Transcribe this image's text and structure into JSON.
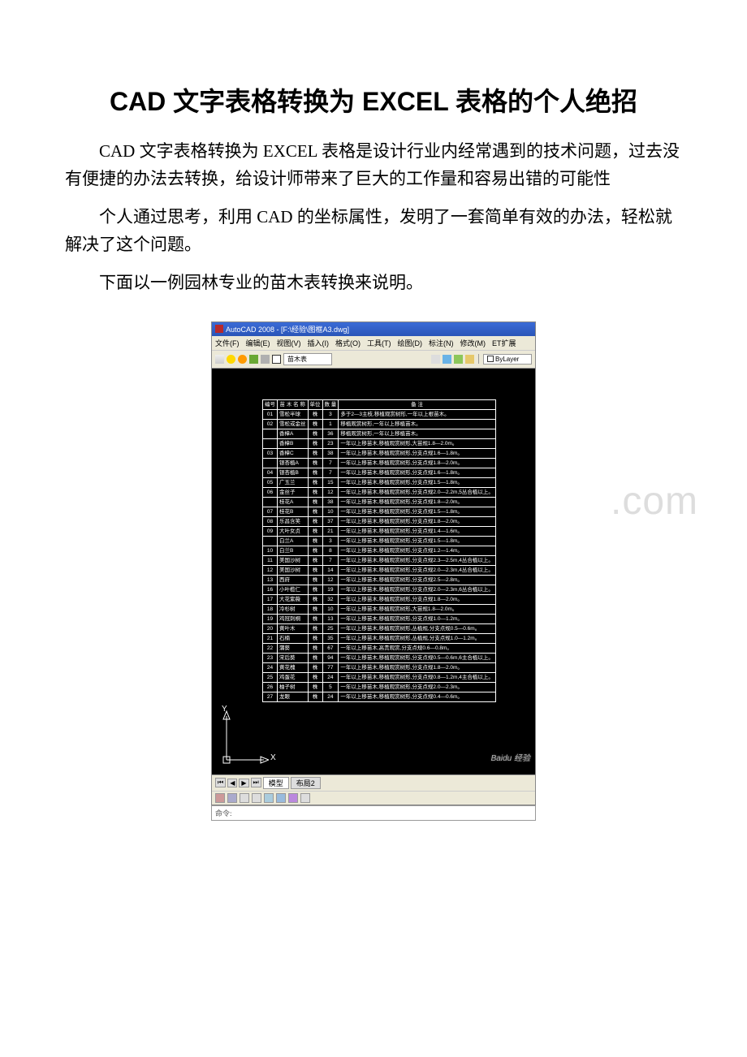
{
  "title": "CAD 文字表格转换为 EXCEL 表格的个人绝招",
  "para1": "CAD 文字表格转换为 EXCEL 表格是设计行业内经常遇到的技术问题，过去没有便捷的办法去转换，给设计师带来了巨大的工作量和容易出错的可能性",
  "para2": "个人通过思考，利用 CAD 的坐标属性，发明了一套简单有效的办法，轻松就解决了这个问题。",
  "para3": "下面以一例园林专业的苗木表转换来说明。",
  "watermark": ".com",
  "window": {
    "app": "AutoCAD 2008 - [F:\\经验\\图框A3.dwg]",
    "menus": [
      "文件(F)",
      "编辑(E)",
      "视图(V)",
      "插入(I)",
      "格式(O)",
      "工具(T)",
      "绘图(D)",
      "标注(N)",
      "修改(M)",
      "ET扩展"
    ],
    "layer_name": "苗木表",
    "bylayer": "ByLayer",
    "model_tab": "模型",
    "layout_tab": "布局2",
    "cmd_label": "命令:",
    "baidu": "Baidu 经验",
    "ucs_x": "X",
    "ucs_y": "Y"
  },
  "table": {
    "header": [
      "编号",
      "苗 木 名 称",
      "单位",
      "数 量",
      "备  注"
    ],
    "rows": [
      [
        "01",
        "雪松半球",
        "株",
        "3",
        "多于2—3主枝,移植观赏树形,一年以上根苗木。"
      ],
      [
        "02",
        "雪松或金丝",
        "株",
        "1",
        "移植观赏树形,一年以上移植苗木。"
      ],
      [
        "",
        "香樟A",
        "株",
        "36",
        "移植观赏树形,一年以上移植苗木。"
      ],
      [
        "",
        "香樟B",
        "株",
        "23",
        "一年以上移苗木,移植观赏树形,大苗规1.8—2.0m。"
      ],
      [
        "03",
        "香樟C",
        "株",
        "38",
        "一年以上移苗木,移植观赏树形,分支点规1.6—1.8m。"
      ],
      [
        "",
        "银杏植A",
        "株",
        "7",
        "一年以上移苗木,移植观赏树形,分支点规1.8—2.0m。"
      ],
      [
        "04",
        "银杏植B",
        "株",
        "7",
        "一年以上移苗木,移植观赏树形,分支点规1.6—1.8m。"
      ],
      [
        "05",
        "广玉兰",
        "株",
        "15",
        "一年以上移苗木,移植观赏树形,分支点规1.5—1.8m。"
      ],
      [
        "06",
        "金丝子",
        "株",
        "12",
        "一年以上移苗木,移植观赏树形,分支点规2.0—2.2m,5丛合植以上。"
      ],
      [
        "",
        "桂花A",
        "株",
        "38",
        "一年以上移苗木,移植观赏树形,分支点规1.8—2.0m。"
      ],
      [
        "07",
        "桂花B",
        "株",
        "10",
        "一年以上移苗木,移植观赏树形,分支点规1.5—1.8m。"
      ],
      [
        "08",
        "乐昌含笑",
        "株",
        "37",
        "一年以上移苗木,移植观赏树形,分支点规1.8—2.0m。"
      ],
      [
        "09",
        "大叶女贞",
        "株",
        "21",
        "一年以上移苗木,移植观赏树形,分支点规1.4—1.6m。"
      ],
      [
        "",
        "白兰A",
        "株",
        "3",
        "一年以上移苗木,移植观赏树形,分支点规1.5—1.8m。"
      ],
      [
        "10",
        "白兰B",
        "株",
        "8",
        "一年以上移苗木,移植观赏树形,分支点规1.2—1.4m。"
      ],
      [
        "11",
        "美国沙树",
        "株",
        "7",
        "一年以上移苗木,移植观赏树形,分支点规2.3—2.5m,4丛合植以上。"
      ],
      [
        "12",
        "美国沙树",
        "株",
        "14",
        "一年以上移苗木,移植观赏树形,分支点规2.0—2.3m,4丛合植以上。"
      ],
      [
        "13",
        "西府",
        "株",
        "12",
        "一年以上移苗木,移植观赏树形,分支点规2.5—2.8m。"
      ],
      [
        "16",
        "小叶榄仁",
        "株",
        "19",
        "一年以上移苗木,移植观赏树形,分支点规2.0—2.3m,6丛合植以上。"
      ],
      [
        "17",
        "大花紫薇",
        "株",
        "32",
        "一年以上移苗木,移植观赏树形,分支点规1.8—2.0m。"
      ],
      [
        "18",
        "冷杉树",
        "株",
        "10",
        "一年以上移苗木,移植观赏树形,大苗规1.8—2.0m。"
      ],
      [
        "19",
        "鸡冠刺桐",
        "株",
        "13",
        "一年以上移苗木,移植观赏树形,分支点规1.0—1.2m。"
      ],
      [
        "20",
        "黄叶木",
        "株",
        "25",
        "一年以上移苗木,移植观赏树形,丛植规,分支点规0.5—0.6m。"
      ],
      [
        "21",
        "石楠",
        "株",
        "35",
        "一年以上移苗木,移植观赏树形,丛植规,分支点规1.0—1.2m。"
      ],
      [
        "22",
        "蒲葵",
        "株",
        "67",
        "一年以上移苗木,高贵观赏,分支点规0.6—0.8m。"
      ],
      [
        "23",
        "宋后葵",
        "株",
        "94",
        "一年以上移苗木,移植观赏树形,分支点规0.5—0.6m,6主合植以上。"
      ],
      [
        "24",
        "黄花槐",
        "株",
        "77",
        "一年以上移苗木,移植观赏树形,分支点规1.8—2.0m。"
      ],
      [
        "25",
        "鸡蛋花",
        "株",
        "24",
        "一年以上移苗木,移植观赏树形,分支点规0.8—1.2m,4主合植以上。"
      ],
      [
        "26",
        "柚子树",
        "株",
        "5",
        "一年以上移苗木,移植观赏树形,分支点规2.0—2.3m。"
      ],
      [
        "27",
        "龙眼",
        "株",
        "24",
        "一年以上移苗木,移植观赏树形,分支点规0.4—0.6m。"
      ]
    ]
  }
}
